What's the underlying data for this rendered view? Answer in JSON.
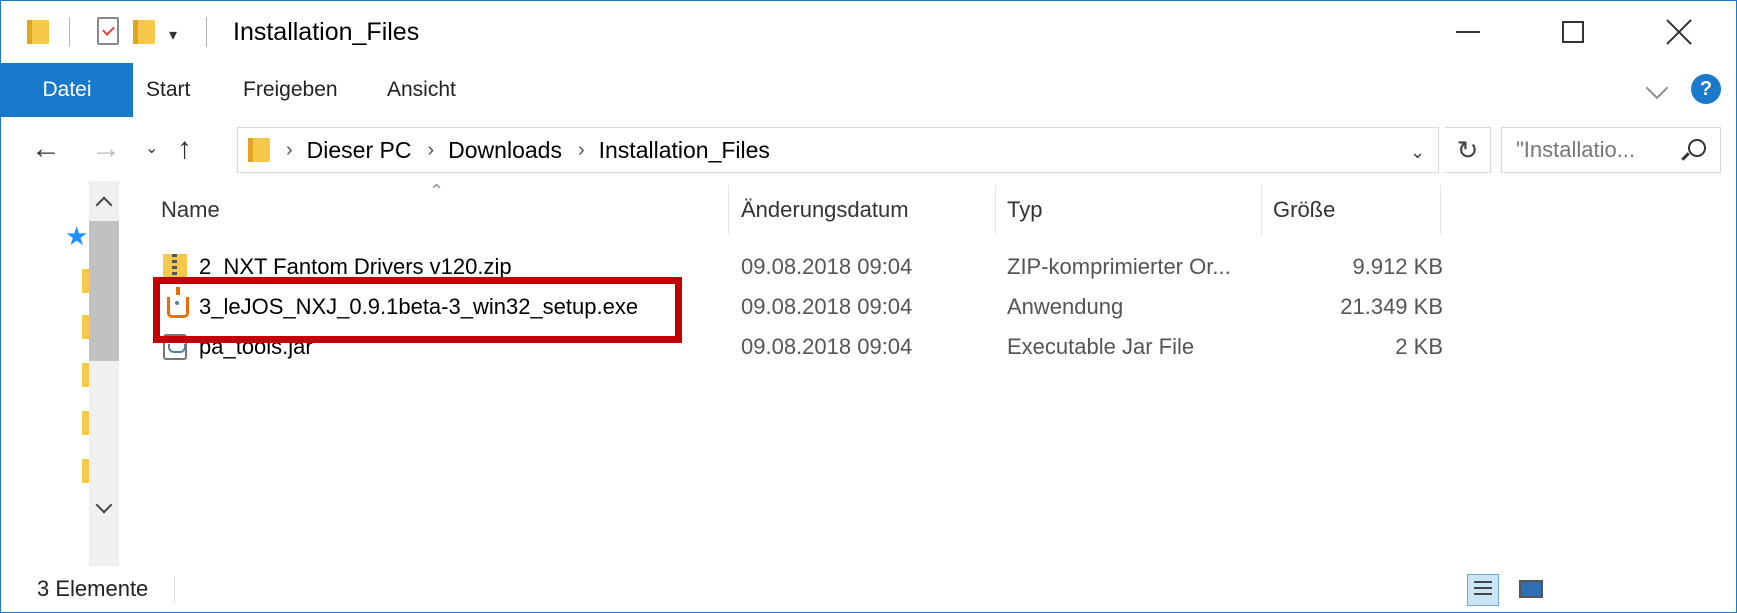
{
  "window": {
    "title": "Installation_Files"
  },
  "title_controls": {
    "minimize_icon": "minimize-icon",
    "maximize_icon": "maximize-icon",
    "close_icon": "close-icon"
  },
  "ribbon": {
    "tabs": [
      {
        "label": "Datei",
        "active": true
      },
      {
        "label": "Start"
      },
      {
        "label": "Freigeben"
      },
      {
        "label": "Ansicht"
      }
    ],
    "help_label": "?"
  },
  "address": {
    "crumbs": [
      "Dieser PC",
      "Downloads",
      "Installation_Files"
    ],
    "search_placeholder": "\"Installatio..."
  },
  "list": {
    "columns": {
      "name": "Name",
      "date": "Änderungsdatum",
      "type": "Typ",
      "size": "Größe"
    },
    "rows": [
      {
        "name": "2_NXT Fantom Drivers v120.zip",
        "date": "09.08.2018 09:04",
        "type": "ZIP-komprimierter Or...",
        "size": "9.912 KB",
        "icon": "zip-icon"
      },
      {
        "name": "3_leJOS_NXJ_0.9.1beta-3_win32_setup.exe",
        "date": "09.08.2018 09:04",
        "type": "Anwendung",
        "size": "21.349 KB",
        "icon": "java-icon"
      },
      {
        "name": "pa_tools.jar",
        "date": "09.08.2018 09:04",
        "type": "Executable Jar File",
        "size": "2 KB",
        "icon": "jar-icon"
      }
    ]
  },
  "status": {
    "count_text": "3 Elemente"
  },
  "colors": {
    "accent": "#1979ca",
    "highlight": "#c00000",
    "folder": "#f7c94a"
  }
}
